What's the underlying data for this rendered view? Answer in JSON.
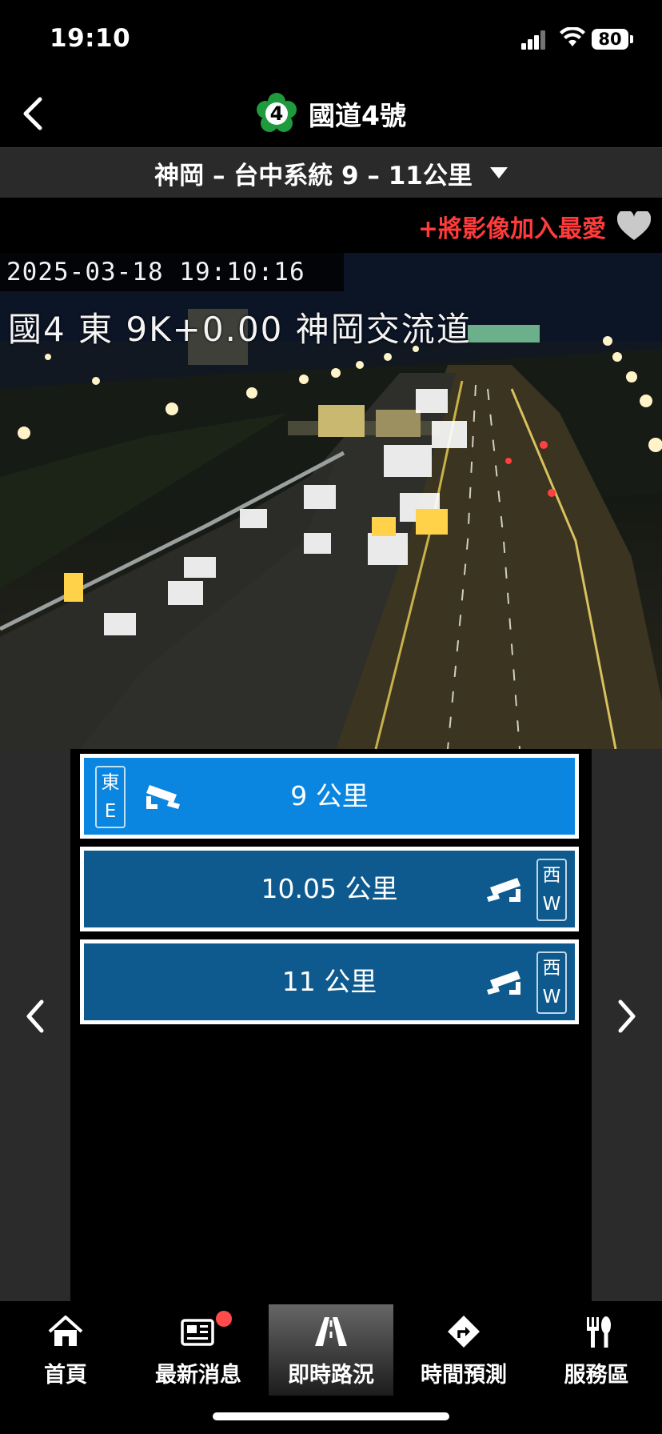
{
  "status_bar": {
    "time": "19:10",
    "battery": "80"
  },
  "header": {
    "route_number": "4",
    "title": "國道4號"
  },
  "segment": {
    "label": "神岡 – 台中系統 9 – 11公里"
  },
  "favorite": {
    "label": "+將影像加入最愛"
  },
  "camera_feed": {
    "timestamp": "2025-03-18 19:10:16",
    "location": "國4 東 9K+0.00 神岡交流道"
  },
  "cameras": [
    {
      "direction_char": "東",
      "direction_letter": "E",
      "label": "9 公里",
      "active": true
    },
    {
      "direction_char": "西",
      "direction_letter": "W",
      "label": "10.05 公里",
      "active": false
    },
    {
      "direction_char": "西",
      "direction_letter": "W",
      "label": "11 公里",
      "active": false
    }
  ],
  "tabs": [
    {
      "label": "首頁",
      "icon": "home-icon"
    },
    {
      "label": "最新消息",
      "icon": "news-icon"
    },
    {
      "label": "即時路況",
      "icon": "road-icon",
      "active": true
    },
    {
      "label": "時間預測",
      "icon": "route-turn-icon"
    },
    {
      "label": "服務區",
      "icon": "utensils-icon"
    }
  ],
  "colors": {
    "accent_red": "#ff3b3b",
    "active_camera": "#0a86e0",
    "inactive_camera": "#0e5a8e",
    "route_badge": "#1f9a3c"
  }
}
